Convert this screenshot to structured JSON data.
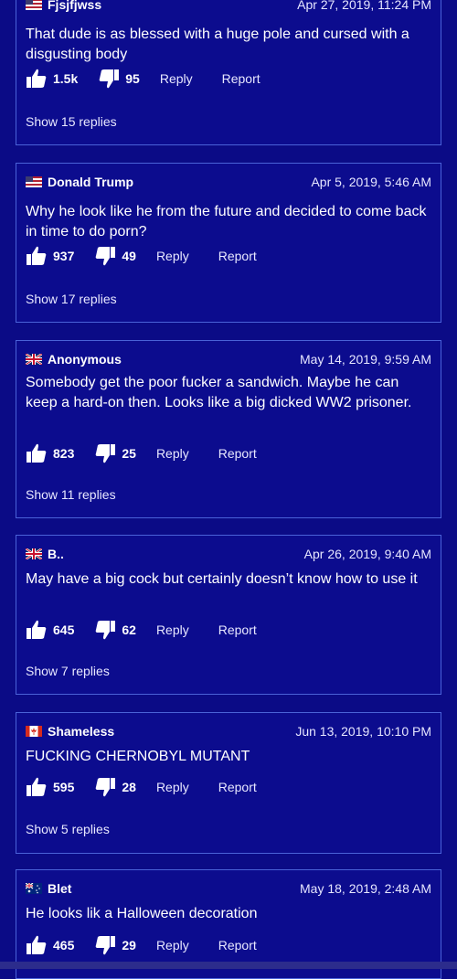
{
  "colors": {
    "background": "#0b0b86",
    "card_border": "#4a62d8",
    "text": "#ffffff"
  },
  "comments": [
    {
      "user": "Fjsjfjwss",
      "flag": "us-flag",
      "date": "Apr 27, 2019, 11:24 PM",
      "text": "That dude is as blessed with a huge pole and cursed with a disgusting body",
      "likes": "1.5k",
      "dislikes": "95",
      "reply": "Reply",
      "report": "Report",
      "replies": "Show 15 replies"
    },
    {
      "user": "Donald Trump",
      "flag": "us-flag",
      "date": "Apr 5, 2019, 5:46 AM",
      "text": "Why he look like he from the future and decided to come back in time to do porn?",
      "likes": "937",
      "dislikes": "49",
      "reply": "Reply",
      "report": "Report",
      "replies": "Show 17 replies"
    },
    {
      "user": "Anonymous",
      "flag": "uk-flag",
      "date": "May 14, 2019, 9:59 AM",
      "text": "Somebody get the poor fucker a sandwich. Maybe he can keep a hard-on then. Looks like a big dicked WW2 prisoner.",
      "likes": "823",
      "dislikes": "25",
      "reply": "Reply",
      "report": "Report",
      "replies": "Show 11 replies"
    },
    {
      "user": "B..",
      "flag": "uk-flag",
      "date": "Apr 26, 2019, 9:40 AM",
      "text": "May have a big cock but certainly doesn’t know how to use it",
      "likes": "645",
      "dislikes": "62",
      "reply": "Reply",
      "report": "Report",
      "replies": "Show 7 replies"
    },
    {
      "user": "Shameless",
      "flag": "canada-flag",
      "date": "Jun 13, 2019, 10:10 PM",
      "text": "FUCKING CHERNOBYL MUTANT",
      "likes": "595",
      "dislikes": "28",
      "reply": "Reply",
      "report": "Report",
      "replies": "Show 5 replies"
    },
    {
      "user": "Blet",
      "flag": "australia-flag",
      "date": "May 18, 2019, 2:48 AM",
      "text": "He looks lik a Halloween decoration",
      "likes": "465",
      "dislikes": "29",
      "reply": "Reply",
      "report": "Report",
      "replies": ""
    }
  ]
}
